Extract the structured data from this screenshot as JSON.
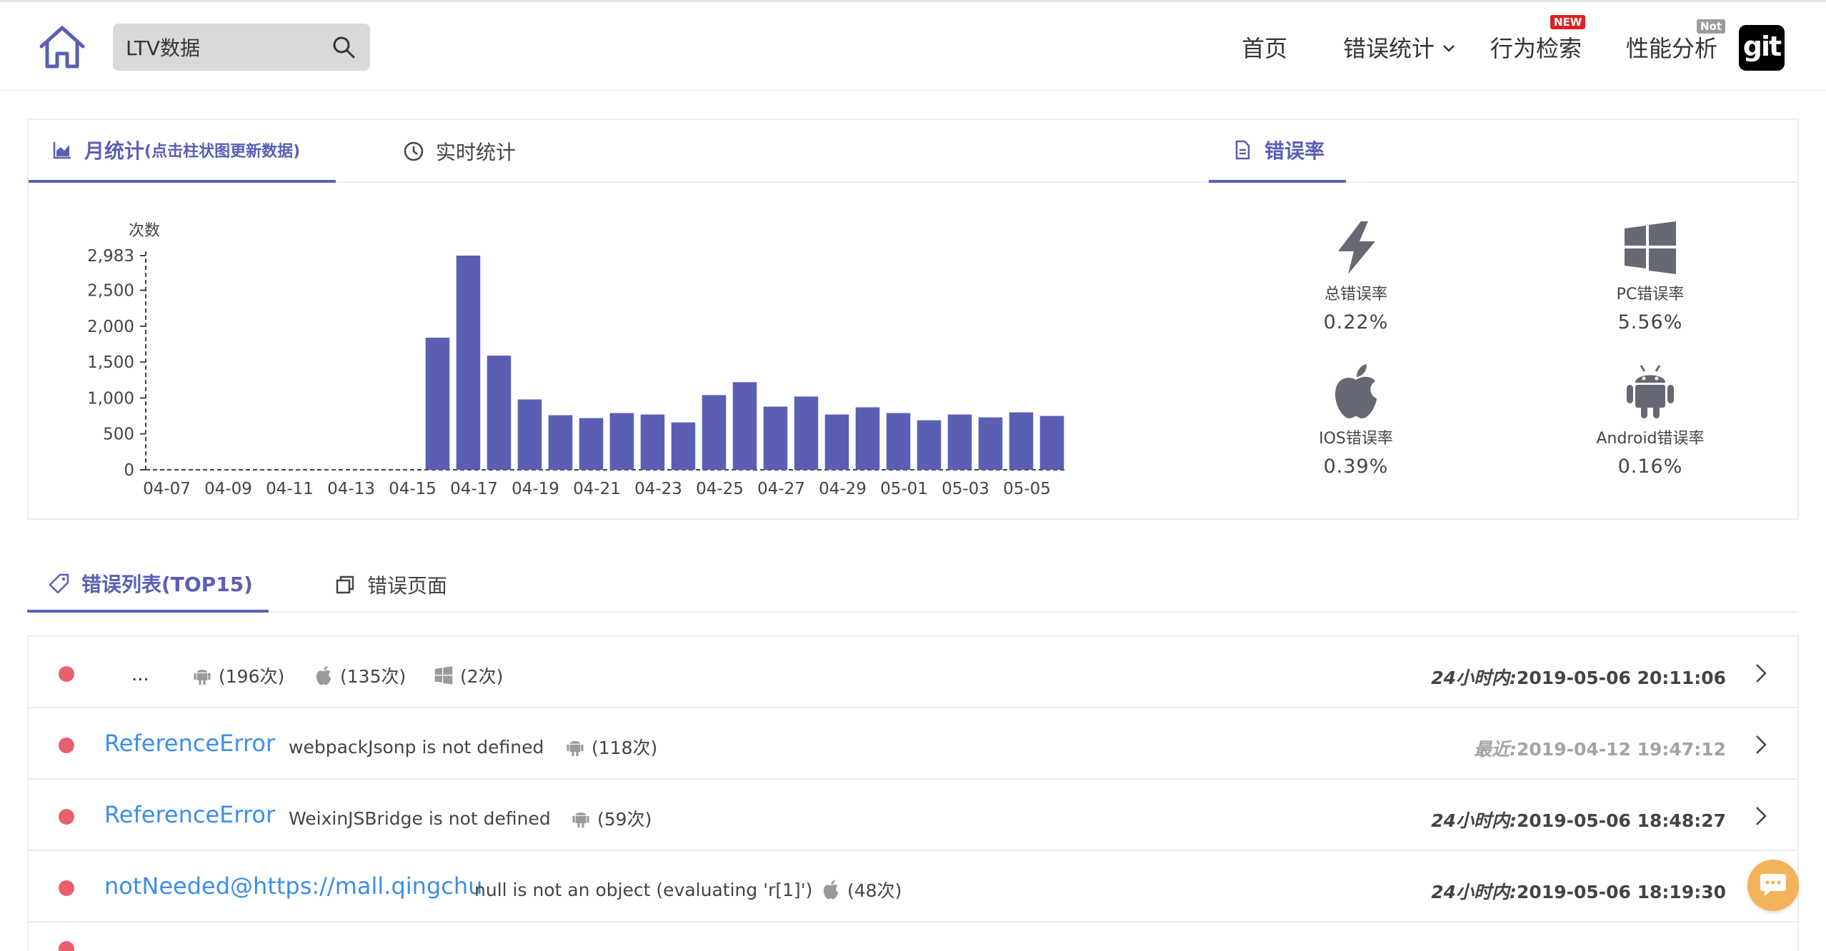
{
  "header": {
    "search": {
      "value": "LTV数据"
    },
    "nav": {
      "home": "首页",
      "errors": "错误统计",
      "behavior": "行为检索",
      "behavior_badge": "NEW",
      "perf": "性能分析",
      "perf_badge": "Not"
    },
    "git_logo": "git"
  },
  "stats_panel": {
    "tabs": {
      "monthly": "月统计",
      "monthly_sub": "(点击柱状图更新数据)",
      "realtime": "实时统计",
      "error_rate": "错误率"
    },
    "rates": [
      {
        "label": "总错误率",
        "value": "0.22%",
        "icon": "lightning-icon"
      },
      {
        "label": "PC错误率",
        "value": "5.56%",
        "icon": "windows-icon"
      },
      {
        "label": "IOS错误率",
        "value": "0.39%",
        "icon": "apple-icon"
      },
      {
        "label": "Android错误率",
        "value": "0.16%",
        "icon": "android-icon"
      }
    ]
  },
  "chart_data": {
    "type": "bar",
    "ylabel": "次数",
    "ylim": [
      0,
      2983
    ],
    "y_ticks": [
      "2,983",
      "2,500",
      "2,000",
      "1,500",
      "1,000",
      "500",
      "0"
    ],
    "y_tick_values": [
      2983,
      2500,
      2000,
      1500,
      1000,
      500,
      0
    ],
    "x_tick_labels": [
      "04-07",
      "04-09",
      "04-11",
      "04-13",
      "04-15",
      "04-17",
      "04-19",
      "04-21",
      "04-23",
      "04-25",
      "04-27",
      "04-29",
      "05-01",
      "05-03",
      "05-05"
    ],
    "categories": [
      "04-07",
      "04-08",
      "04-09",
      "04-10",
      "04-11",
      "04-12",
      "04-13",
      "04-14",
      "04-15",
      "04-16",
      "04-17",
      "04-18",
      "04-19",
      "04-20",
      "04-21",
      "04-22",
      "04-23",
      "04-24",
      "04-25",
      "04-26",
      "04-27",
      "04-28",
      "04-29",
      "04-30",
      "05-01",
      "05-02",
      "05-03",
      "05-04",
      "05-05",
      "05-06"
    ],
    "values": [
      0,
      0,
      0,
      0,
      0,
      0,
      0,
      0,
      0,
      1840,
      2983,
      1590,
      980,
      760,
      720,
      790,
      770,
      660,
      1040,
      1220,
      880,
      1020,
      770,
      870,
      790,
      690,
      770,
      730,
      800,
      750
    ],
    "color": "#5a5fb4",
    "grid": false
  },
  "list_tabs": {
    "errors": "错误列表(TOP15)",
    "pages": "错误页面"
  },
  "errors": [
    {
      "type": "...",
      "message": "",
      "platforms": [
        {
          "icon": "android-icon",
          "count": "(196次)"
        },
        {
          "icon": "apple-icon",
          "count": "(135次)"
        },
        {
          "icon": "windows-icon",
          "count": "(2次)"
        }
      ],
      "time_prefix": "24小时内:",
      "time": "2019-05-06 20:11:06",
      "recent": false
    },
    {
      "type": "ReferenceError",
      "message": "webpackJsonp is not defined",
      "platforms": [
        {
          "icon": "android-icon",
          "count": "(118次)"
        }
      ],
      "time_prefix": "最近:",
      "time": "2019-04-12 19:47:12",
      "recent": true
    },
    {
      "type": "ReferenceError",
      "message": "WeixinJSBridge is not defined",
      "platforms": [
        {
          "icon": "android-icon",
          "count": "(59次)"
        }
      ],
      "time_prefix": "24小时内:",
      "time": "2019-05-06 18:48:27",
      "recent": false
    },
    {
      "type": "notNeeded@https://mall.qingchu",
      "message": "null is not an object (evaluating 'r[1]')",
      "platforms": [
        {
          "icon": "apple-icon",
          "count": "(48次)"
        }
      ],
      "time_prefix": "24小时内:",
      "time": "2019-05-06 18:19:30",
      "recent": false
    }
  ],
  "colors": {
    "accent": "#5a5fb4",
    "link": "#3d8ee8",
    "error_dot": "#e8606d",
    "chat": "#f3b35a"
  }
}
